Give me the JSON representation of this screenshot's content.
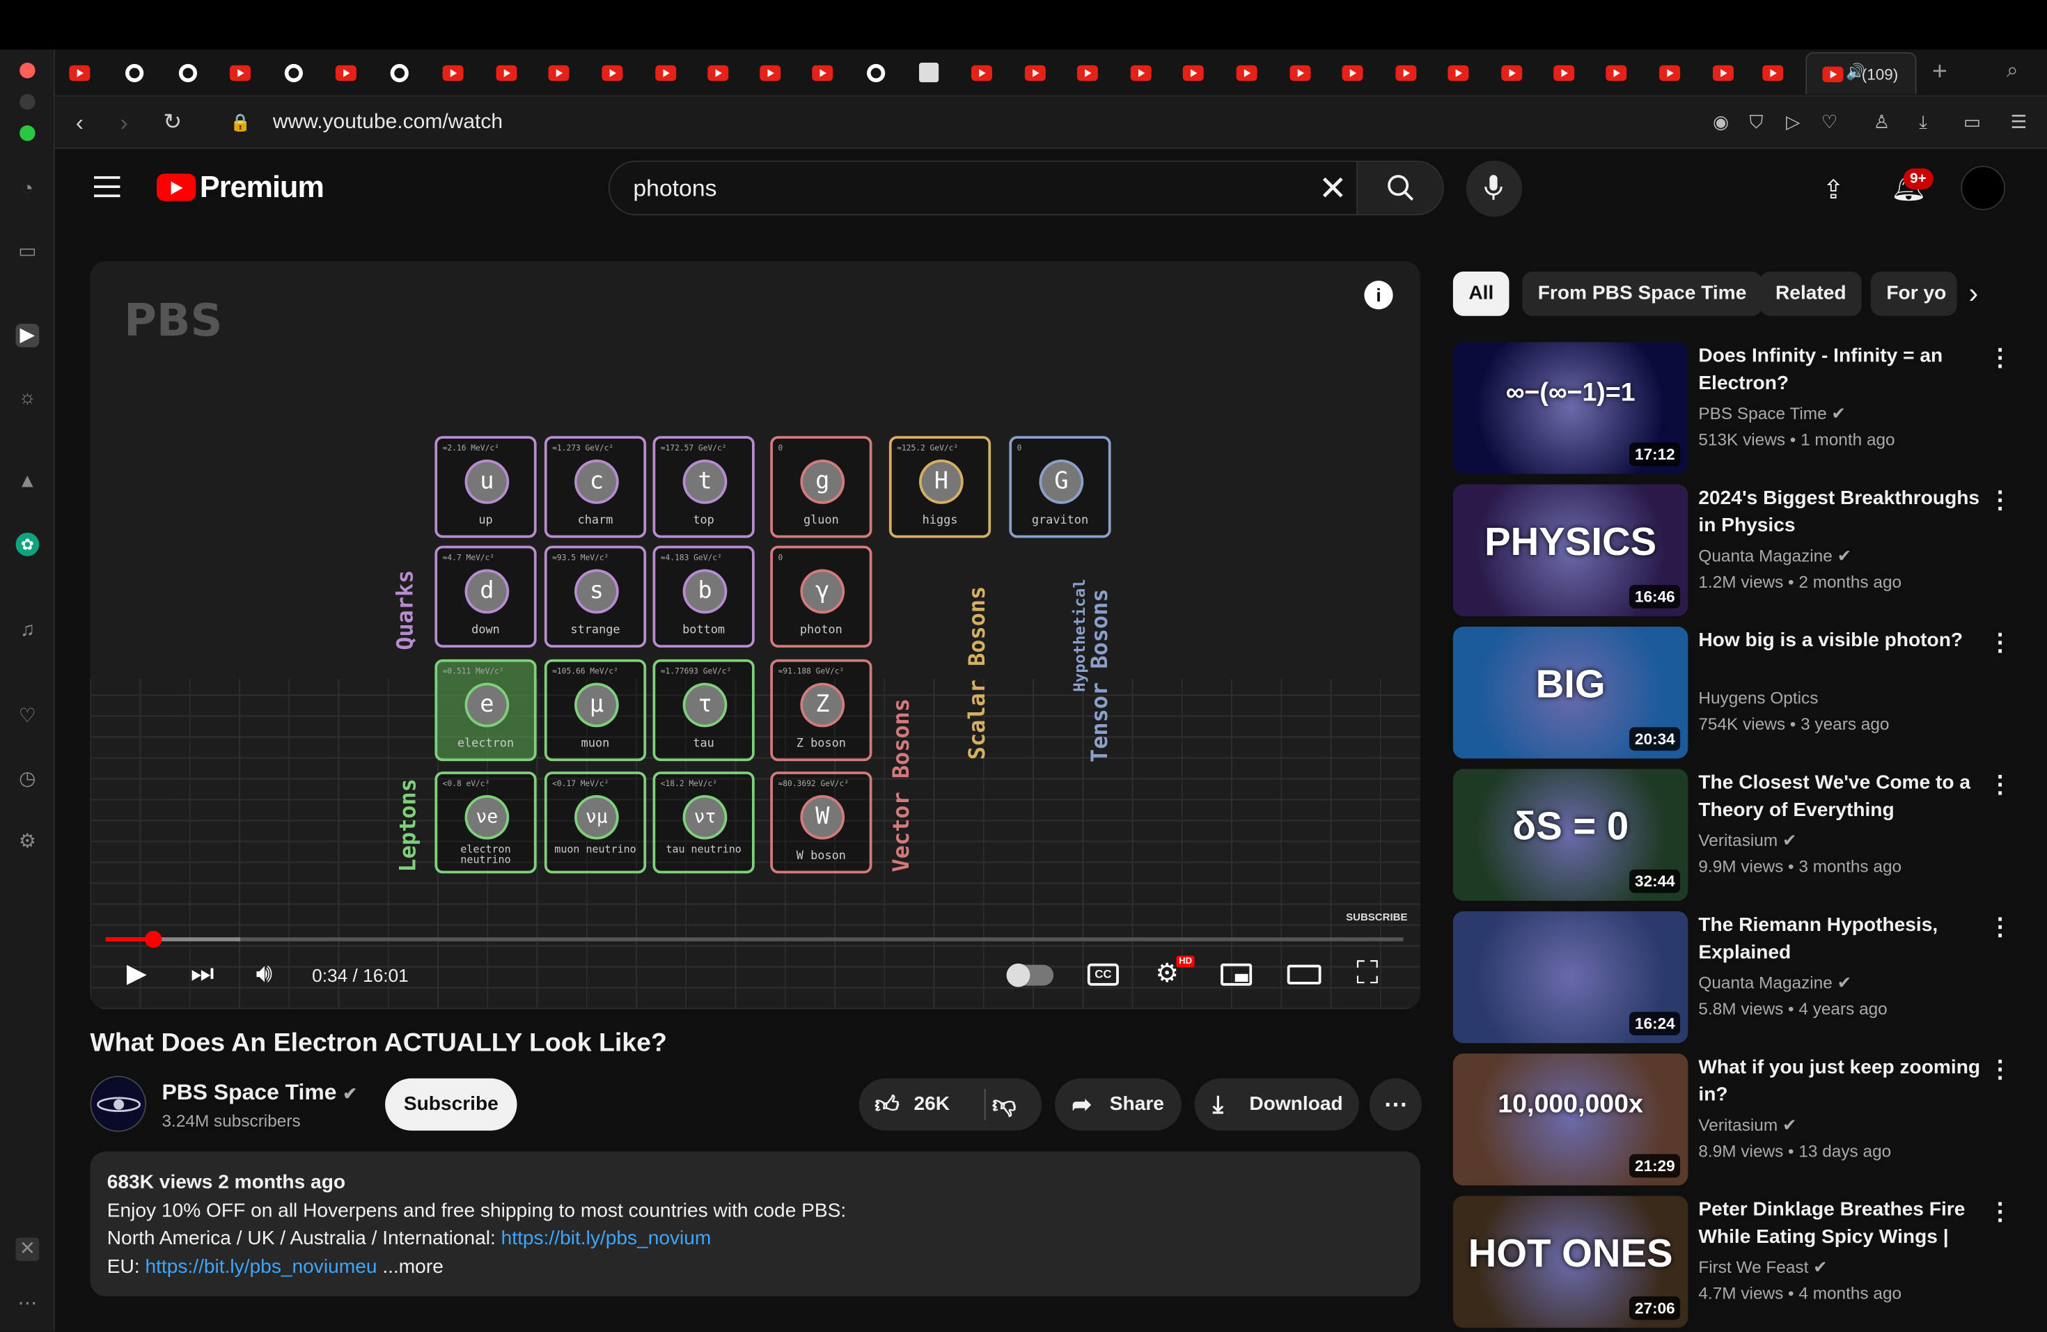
{
  "browser": {
    "url": "www.youtube.com/watch",
    "active_tab_label": "(109)"
  },
  "header": {
    "logo_text": "Premium",
    "search_value": "photons",
    "notification_badge": "9+"
  },
  "player": {
    "watermark": "PBS",
    "time": "0:34 / 16:01",
    "subscribe_watermark": "SUBSCRIBE",
    "progress_fraction": 0.035,
    "cards": [
      {
        "sym": "u",
        "name": "up",
        "mass": "≈2.16 MeV/c²",
        "color": "#b88bd0"
      },
      {
        "sym": "c",
        "name": "charm",
        "mass": "≈1.273 GeV/c²",
        "color": "#b88bd0"
      },
      {
        "sym": "t",
        "name": "top",
        "mass": "≈172.57 GeV/c²",
        "color": "#b88bd0"
      },
      {
        "sym": "g",
        "name": "gluon",
        "mass": "0",
        "color": "#d47a7a"
      },
      {
        "sym": "H",
        "name": "higgs",
        "mass": "≈125.2 GeV/c²",
        "color": "#d4b060"
      },
      {
        "sym": "G",
        "name": "graviton",
        "mass": "0",
        "color": "#8aa0c8"
      },
      {
        "sym": "d",
        "name": "down",
        "mass": "≈4.7 MeV/c²",
        "color": "#b88bd0"
      },
      {
        "sym": "s",
        "name": "strange",
        "mass": "≈93.5 MeV/c²",
        "color": "#b88bd0"
      },
      {
        "sym": "b",
        "name": "bottom",
        "mass": "≈4.183 GeV/c²",
        "color": "#b88bd0"
      },
      {
        "sym": "γ",
        "name": "photon",
        "mass": "0",
        "color": "#d47a7a"
      },
      {
        "sym": "e",
        "name": "electron",
        "mass": "≈0.511 MeV/c²",
        "color": "#7ed07a"
      },
      {
        "sym": "μ",
        "name": "muon",
        "mass": "≈105.66 MeV/c²",
        "color": "#7ed07a"
      },
      {
        "sym": "τ",
        "name": "tau",
        "mass": "≈1.77693 GeV/c²",
        "color": "#7ed07a"
      },
      {
        "sym": "Z",
        "name": "Z boson",
        "mass": "≈91.188 GeV/c²",
        "color": "#d47a7a"
      },
      {
        "sym": "νe",
        "name": "electron neutrino",
        "mass": "<0.8 eV/c²",
        "color": "#7ed07a"
      },
      {
        "sym": "νμ",
        "name": "muon neutrino",
        "mass": "<0.17 MeV/c²",
        "color": "#7ed07a"
      },
      {
        "sym": "ντ",
        "name": "tau neutrino",
        "mass": "<18.2 MeV/c²",
        "color": "#7ed07a"
      },
      {
        "sym": "W",
        "name": "W boson",
        "mass": "≈80.3692 GeV/c²",
        "color": "#d47a7a"
      }
    ],
    "labels": {
      "quarks": "Quarks",
      "leptons": "Leptons",
      "vector": "Vector Bosons",
      "scalar": "Scalar Bosons",
      "tensor": "Tensor Bosons",
      "hypothetical": "Hypothetical"
    }
  },
  "video": {
    "title": "What Does An Electron ACTUALLY Look Like?",
    "channel": "PBS Space Time",
    "subscribers": "3.24M subscribers",
    "subscribe_label": "Subscribe",
    "likes": "26K",
    "share_label": "Share",
    "download_label": "Download",
    "description": {
      "stats": "683K views  2 months ago",
      "line1": "Enjoy 10% OFF on all Hoverpens and free shipping to most countries with code PBS:",
      "line2_text": "North America / UK / Australia / International: ",
      "line2_link": "https://bit.ly/pbs_novium",
      "line3_text": "EU: ",
      "line3_link": "https://bit.ly/pbs_noviumeu",
      "more": "...more"
    }
  },
  "chips": [
    "All",
    "From PBS Space Time",
    "Related",
    "For yo"
  ],
  "recommendations": [
    {
      "title": "Does Infinity - Infinity = an Electron?",
      "channel": "PBS Space Time",
      "verified": true,
      "views": "513K views",
      "age": "1 month ago",
      "duration": "17:12",
      "thumb_text": "∞−(∞−1)=1",
      "thumb_bg": "#0a0a3a"
    },
    {
      "title": "2024's Biggest Breakthroughs in Physics",
      "channel": "Quanta Magazine",
      "verified": true,
      "views": "1.2M views",
      "age": "2 months ago",
      "duration": "16:46",
      "thumb_text": "PHYSICS",
      "thumb_bg": "#2a1a4a"
    },
    {
      "title": "How big is a visible photon?",
      "channel": "Huygens Optics",
      "verified": false,
      "views": "754K views",
      "age": "3 years ago",
      "duration": "20:34",
      "thumb_text": "BIG",
      "thumb_bg": "#1a5a9a"
    },
    {
      "title": "The Closest We've Come to a Theory of Everything",
      "channel": "Veritasium",
      "verified": true,
      "views": "9.9M views",
      "age": "3 months ago",
      "duration": "32:44",
      "thumb_text": "δS = 0",
      "thumb_bg": "#1e3a24"
    },
    {
      "title": "The Riemann Hypothesis, Explained",
      "channel": "Quanta Magazine",
      "verified": true,
      "views": "5.8M views",
      "age": "4 years ago",
      "duration": "16:24",
      "thumb_text": "",
      "thumb_bg": "#2a3a6a"
    },
    {
      "title": "What if you just keep zooming in?",
      "channel": "Veritasium",
      "verified": true,
      "views": "8.9M views",
      "age": "13 days ago",
      "duration": "21:29",
      "thumb_text": "10,000,000x",
      "thumb_bg": "#5a3a2a"
    },
    {
      "title": "Peter Dinklage Breathes Fire While Eating Spicy Wings | Hot…",
      "channel": "First We Feast",
      "verified": true,
      "views": "4.7M views",
      "age": "4 months ago",
      "duration": "27:06",
      "thumb_text": "HOT ONES",
      "thumb_bg": "#3a2a1a"
    }
  ]
}
